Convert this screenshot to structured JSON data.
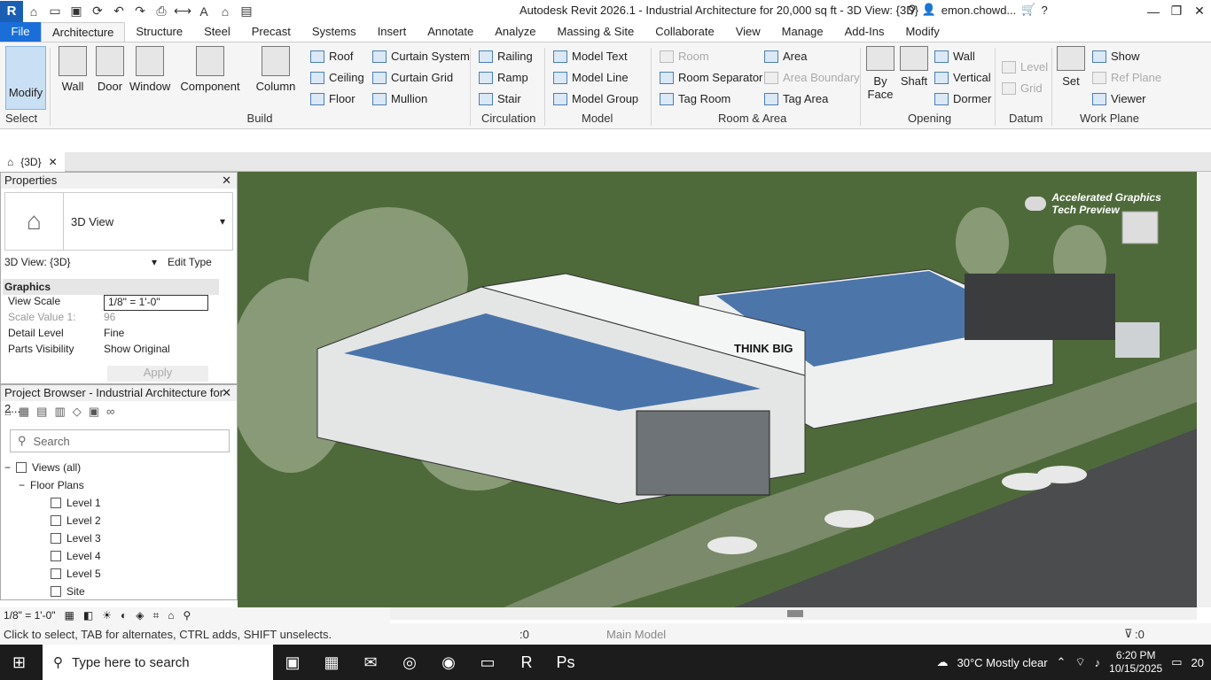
{
  "titlebar": {
    "logo": "R",
    "app_title": "Autodesk Revit 2026.1 - Industrial Architecture for 20,000 sq ft - 3D View: {3D}",
    "user": "emon.chowd..."
  },
  "tabs": [
    "File",
    "Architecture",
    "Structure",
    "Steel",
    "Precast",
    "Systems",
    "Insert",
    "Annotate",
    "Analyze",
    "Massing & Site",
    "Collaborate",
    "View",
    "Manage",
    "Add-Ins",
    "Modify"
  ],
  "ribbon": {
    "modify": "Modify",
    "select": "Select",
    "build": {
      "label": "Build",
      "big": [
        "Wall",
        "Door",
        "Window",
        "Component",
        "Column"
      ],
      "small": [
        "Roof",
        "Ceiling",
        "Floor",
        "Curtain System",
        "Curtain Grid",
        "Mullion"
      ]
    },
    "circulation": {
      "label": "Circulation",
      "items": [
        "Railing",
        "Ramp",
        "Stair"
      ]
    },
    "model": {
      "label": "Model",
      "items": [
        "Model Text",
        "Model Line",
        "Model Group"
      ]
    },
    "room_area": {
      "label": "Room & Area",
      "items": [
        "Room",
        "Room Separator",
        "Tag Room",
        "Area",
        "Area Boundary",
        "Tag Area"
      ]
    },
    "opening": {
      "label": "Opening",
      "big": [
        "By Face",
        "Shaft"
      ],
      "small": [
        "Wall",
        "Vertical",
        "Dormer"
      ]
    },
    "datum": {
      "label": "Datum",
      "items": [
        "Level",
        "Grid"
      ]
    },
    "work_plane": {
      "label": "Work Plane",
      "big": "Set",
      "items": [
        "Show",
        "Ref Plane",
        "Viewer"
      ]
    }
  },
  "view_tab": "{3D}",
  "properties": {
    "title": "Properties",
    "type": "3D View",
    "selector": "3D View: {3D}",
    "edit_type": "Edit Type",
    "section": "Graphics",
    "rows": [
      {
        "k": "View Scale",
        "v": "1/8\" = 1'-0\""
      },
      {
        "k": "Scale Value   1:",
        "v": "96"
      },
      {
        "k": "Detail Level",
        "v": "Fine"
      },
      {
        "k": "Parts Visibility",
        "v": "Show Original"
      }
    ],
    "apply": "Apply"
  },
  "browser": {
    "title": "Project Browser - Industrial Architecture for 2...",
    "search_placeholder": "Search",
    "root": "Views (all)",
    "group": "Floor Plans",
    "items": [
      "Level 1",
      "Level 2",
      "Level 3",
      "Level 4",
      "Level 5",
      "Site"
    ]
  },
  "viewport": {
    "graphics_toggle": "Accelerated Graphics Tech Preview",
    "sign": "THINK BIG"
  },
  "view_control": {
    "scale": "1/8\" = 1'-0\""
  },
  "status": {
    "hint": "Click to select, TAB for alternates, CTRL adds, SHIFT unselects.",
    "count": ":0",
    "model": "Main Model",
    "filter": ":0"
  },
  "taskbar": {
    "search": "Type here to search",
    "weather": "30°C  Mostly clear",
    "time": "6:20 PM",
    "date": "10/15/2025",
    "notif": "20"
  },
  "colors": {
    "accent": "#1a6ed8",
    "grass": "#4f6a3a",
    "building": "#eef0f0",
    "solar": "#2f5f9e"
  }
}
